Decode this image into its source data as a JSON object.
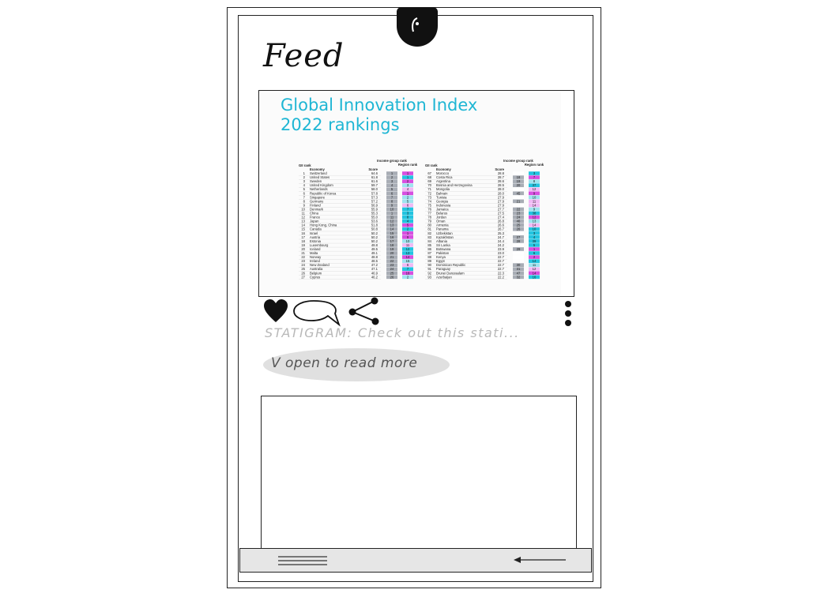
{
  "header": {
    "title": "Feed"
  },
  "post": {
    "image": {
      "title_line1": "Global Innovation Index",
      "title_line2": "2022 rankings",
      "table_headers": [
        "GII rank",
        "Economy",
        "Score",
        "Income group rank",
        "Region rank"
      ],
      "left_rows": [
        [
          "1",
          "Switzerland",
          "64.6",
          "1",
          "1"
        ],
        [
          "2",
          "United States",
          "61.8",
          "2",
          "1"
        ],
        [
          "3",
          "Sweden",
          "61.6",
          "3",
          "2"
        ],
        [
          "4",
          "United Kingdom",
          "59.7",
          "4",
          "3"
        ],
        [
          "5",
          "Netherlands",
          "58.0",
          "5",
          "4"
        ],
        [
          "6",
          "Republic of Korea",
          "57.8",
          "6",
          "1"
        ],
        [
          "7",
          "Singapore",
          "57.3",
          "7",
          "2"
        ],
        [
          "8",
          "Germany",
          "57.2",
          "8",
          "5"
        ],
        [
          "9",
          "Finland",
          "56.9",
          "9",
          "6"
        ],
        [
          "10",
          "Denmark",
          "55.9",
          "10",
          "7"
        ],
        [
          "11",
          "China",
          "55.3",
          "1",
          "3"
        ],
        [
          "12",
          "France",
          "55.0",
          "11",
          "8"
        ],
        [
          "13",
          "Japan",
          "53.6",
          "12",
          "4"
        ],
        [
          "14",
          "Hong Kong, China",
          "51.8",
          "13",
          "5"
        ],
        [
          "15",
          "Canada",
          "50.8",
          "14",
          "2"
        ],
        [
          "16",
          "Israel",
          "50.2",
          "15",
          "1"
        ],
        [
          "17",
          "Austria",
          "50.2",
          "16",
          "9"
        ],
        [
          "18",
          "Estonia",
          "50.2",
          "17",
          "10"
        ],
        [
          "19",
          "Luxembourg",
          "49.8",
          "18",
          "11"
        ],
        [
          "20",
          "Iceland",
          "49.5",
          "19",
          "12"
        ],
        [
          "21",
          "Malta",
          "49.1",
          "20",
          "13"
        ],
        [
          "22",
          "Norway",
          "48.8",
          "21",
          "14"
        ],
        [
          "23",
          "Ireland",
          "48.5",
          "22",
          "15"
        ],
        [
          "24",
          "New Zealand",
          "47.2",
          "23",
          "6"
        ],
        [
          "25",
          "Australia",
          "47.1",
          "24",
          "7"
        ],
        [
          "26",
          "Belgium",
          "46.9",
          "25",
          "16"
        ],
        [
          "27",
          "Cyprus",
          "46.2",
          "26",
          "2"
        ]
      ],
      "right_rows": [
        [
          "67",
          "Morocco",
          "28.8",
          "",
          "3"
        ],
        [
          "68",
          "Costa Rica",
          "28.7",
          "18",
          "7"
        ],
        [
          "69",
          "Argentina",
          "28.6",
          "19",
          "8"
        ],
        [
          "70",
          "Bosnia and Herzegovina",
          "28.5",
          "20",
          "37"
        ],
        [
          "71",
          "Mongolia",
          "28.0",
          "",
          "12"
        ],
        [
          "72",
          "Bahrain",
          "28.0",
          "45",
          "9"
        ],
        [
          "73",
          "Tunisia",
          "27.9",
          "",
          "10"
        ],
        [
          "74",
          "Georgia",
          "27.9",
          "21",
          "11"
        ],
        [
          "75",
          "Indonesia",
          "27.9",
          "",
          "14"
        ],
        [
          "76",
          "Jamaica",
          "27.7",
          "22",
          "9"
        ],
        [
          "77",
          "Belarus",
          "27.5",
          "23",
          "38"
        ],
        [
          "78",
          "Jordan",
          "27.4",
          "24",
          "12"
        ],
        [
          "79",
          "Oman",
          "26.8",
          "46",
          "13"
        ],
        [
          "80",
          "Armenia",
          "26.6",
          "25",
          "14"
        ],
        [
          "81",
          "Panama",
          "26.7",
          "26",
          "10"
        ],
        [
          "82",
          "Uzbekistan",
          "25.3",
          "",
          "3"
        ],
        [
          "83",
          "Kazakhstan",
          "24.7",
          "27",
          "4"
        ],
        [
          "84",
          "Albania",
          "24.4",
          "28",
          "39"
        ],
        [
          "85",
          "Sri Lanka",
          "24.2",
          "",
          "5"
        ],
        [
          "86",
          "Botswana",
          "23.9",
          "29",
          "1"
        ],
        [
          "87",
          "Pakistan",
          "23.0",
          "",
          "6"
        ],
        [
          "88",
          "Kenya",
          "22.7",
          "",
          "2"
        ],
        [
          "89",
          "Egypt",
          "22.7",
          "",
          "14"
        ],
        [
          "90",
          "Dominican Republic",
          "22.7",
          "30",
          "11"
        ],
        [
          "91",
          "Paraguay",
          "22.7",
          "31",
          "12"
        ],
        [
          "92",
          "Brunei Darussalam",
          "22.3",
          "47",
          "14"
        ],
        [
          "93",
          "Azerbaijan",
          "22.2",
          "32",
          "16"
        ]
      ]
    },
    "caption": "STATIGRAM: Check out this stati...",
    "read_more": "V open to read more"
  },
  "icons": {
    "notch": "camera-notch-icon",
    "like": "heart-icon",
    "comment": "comment-icon",
    "share": "share-icon",
    "more": "more-vertical-icon",
    "menu": "menu-icon",
    "back": "back-arrow-icon"
  },
  "colors": {
    "title_cyan": "#1fb6d4",
    "region_cyan": "#22c4e0",
    "region_magenta": "#d74fe0",
    "region_light_magenta": "#f1b9f5",
    "income_gray": "#a8adb5",
    "bottom_bar": "#e6e6e6"
  }
}
